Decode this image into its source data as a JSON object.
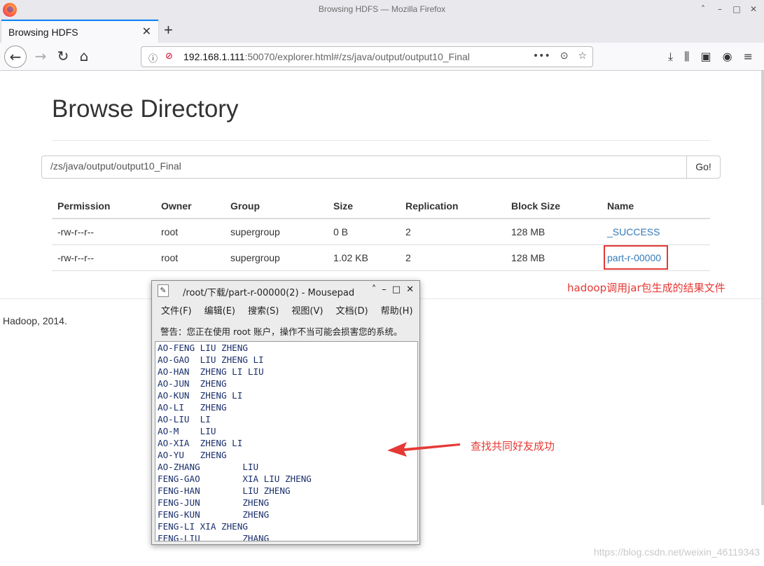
{
  "window": {
    "title": "Browsing HDFS — Mozilla Firefox",
    "min_icon": "˄",
    "minimize_icon": "–",
    "maximize_icon": "□",
    "close_icon": "✕"
  },
  "tab": {
    "label": "Browsing HDFS",
    "close": "✕",
    "new_tab": "+"
  },
  "nav": {
    "back": "←",
    "forward": "→",
    "reload": "↻",
    "home": "⌂",
    "url_host": "192.168.1.111",
    "url_rest": ":50070/explorer.html#/zs/java/output/output10_Final",
    "url_actions": [
      "•••",
      "⊙",
      "☆"
    ],
    "toolbar_icons": [
      "⤓",
      "⫼",
      "▣",
      "◉",
      "≡"
    ]
  },
  "page": {
    "heading": "Browse Directory",
    "path_value": "/zs/java/output/output10_Final",
    "go_label": "Go!",
    "columns": [
      "Permission",
      "Owner",
      "Group",
      "Size",
      "Replication",
      "Block Size",
      "Name"
    ],
    "rows": [
      {
        "permission": "-rw-r--r--",
        "owner": "root",
        "group": "supergroup",
        "size": "0 B",
        "replication": "2",
        "block_size": "128 MB",
        "name": "_SUCCESS"
      },
      {
        "permission": "-rw-r--r--",
        "owner": "root",
        "group": "supergroup",
        "size": "1.02 KB",
        "replication": "2",
        "block_size": "128 MB",
        "name": "part-r-00000"
      }
    ],
    "footer": "Hadoop, 2014."
  },
  "annotations": {
    "result_note": "hadoop调用jar包生成的结果文件",
    "arrow_note": "查找共同好友成功",
    "highlight_color": "#e53935"
  },
  "mousepad": {
    "title": "/root/下载/part-r-00000(2) - Mousepad",
    "menu": [
      "文件(F)",
      "编辑(E)",
      "搜索(S)",
      "视图(V)",
      "文档(D)",
      "帮助(H)"
    ],
    "warning": "警告：您正在使用 root 账户，操作不当可能会损害您的系统。",
    "lines": [
      "AO-FENG LIU ZHENG",
      "AO-GAO  LIU ZHENG LI",
      "AO-HAN  ZHENG LI LIU",
      "AO-JUN  ZHENG",
      "AO-KUN  ZHENG LI",
      "AO-LI   ZHENG",
      "AO-LIU  LI",
      "AO-M    LIU",
      "AO-XIA  ZHENG LI",
      "AO-YU   ZHENG",
      "AO-ZHANG        LIU",
      "FENG-GAO        XIA LIU ZHENG",
      "FENG-HAN        LIU ZHENG",
      "FENG-JUN        ZHENG",
      "FENG-KUN        ZHENG",
      "FENG-LI XIA ZHENG",
      "FENG-LIU        ZHANG"
    ]
  },
  "watermark": "https://blog.csdn.net/weixin_46119343"
}
